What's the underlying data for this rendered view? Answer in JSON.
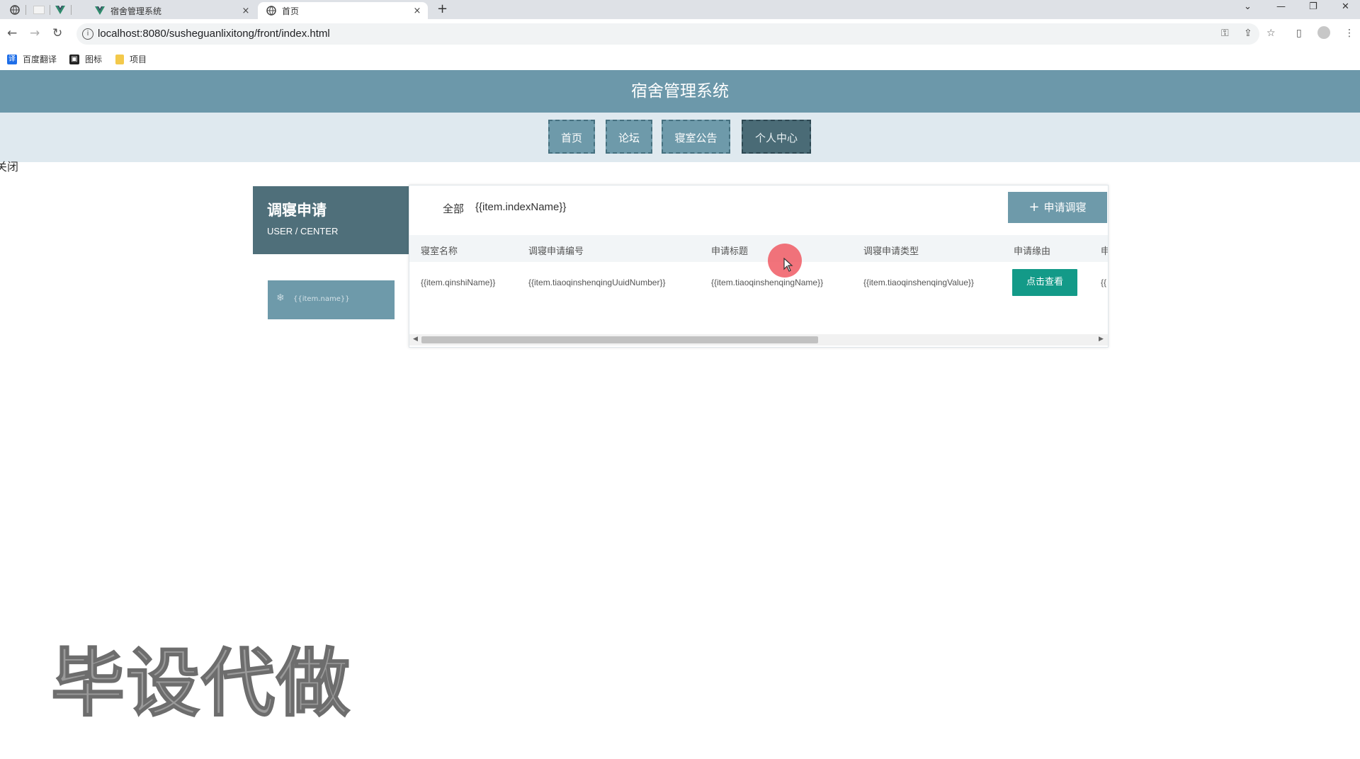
{
  "browser": {
    "tabs": [
      {
        "title": "宿舍管理系统",
        "close": "×"
      },
      {
        "title": "首页",
        "close": "×"
      }
    ],
    "new_tab": "+",
    "url": "localhost:8080/susheguanlixitong/front/index.html",
    "bookmarks": [
      {
        "label": "百度翻译",
        "icon": "translate-icon",
        "color": "#1e6ee8"
      },
      {
        "label": "图标",
        "icon": "image-icon",
        "color": "#222222"
      },
      {
        "label": "项目",
        "icon": "folder-icon",
        "color": "#f3c94b"
      }
    ]
  },
  "site": {
    "title": "宿舍管理系统",
    "nav": [
      {
        "label": "首页",
        "active": false
      },
      {
        "label": "论坛",
        "active": false
      },
      {
        "label": "寝室公告",
        "active": false
      },
      {
        "label": "个人中心",
        "active": true
      }
    ],
    "close_text": "关闭"
  },
  "sidebar": {
    "title": "调寝申请",
    "subtitle": "USER / CENTER",
    "item_label": "{{item.name}}",
    "item_icon": "snowflake-icon"
  },
  "main": {
    "filter_all": "全部",
    "filter_index": "{{item.indexName}}",
    "apply_button": "申请调寝",
    "columns": [
      "寝室名称",
      "调寝申请编号",
      "申请标题",
      "调寝申请类型",
      "申请缘由",
      "申"
    ],
    "row": [
      "{{item.qinshiName}}",
      "{{item.tiaoqinshenqingUuidNumber}}",
      "{{item.tiaoqinshenqingName}}",
      "{{item.tiaoqinshenqingValue}}",
      "{{"
    ],
    "view_button": "点击查看"
  },
  "watermark": "毕设代做",
  "colors": {
    "header": "#6c98aa",
    "nav_bg": "#dfe9ef",
    "nav_active": "#4a6b76",
    "sidebar_head": "#4f6f7a",
    "view_button": "#139a88"
  }
}
